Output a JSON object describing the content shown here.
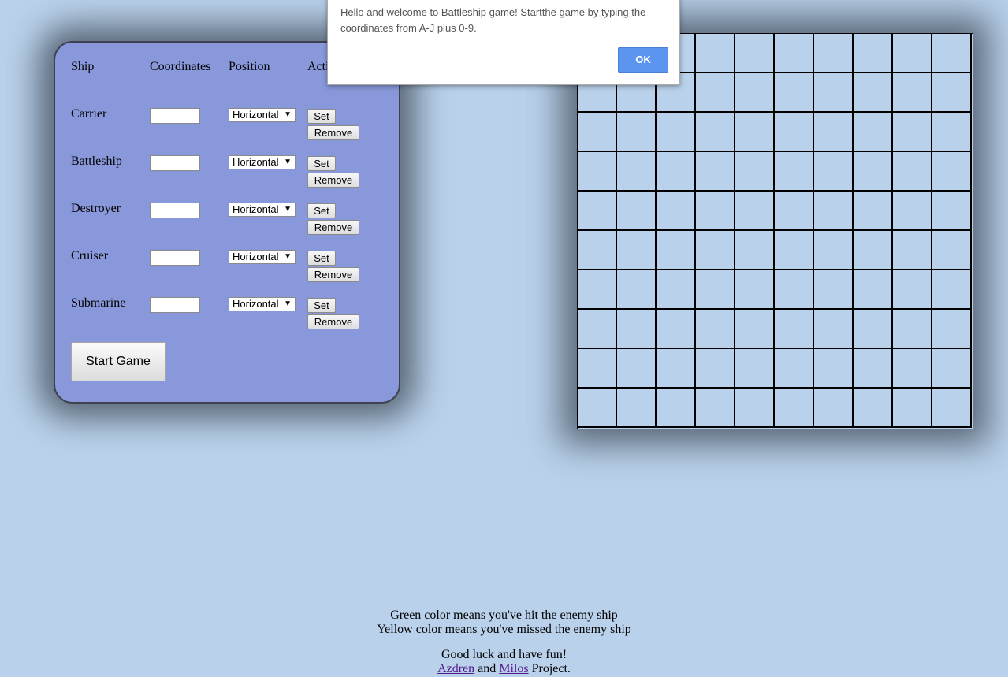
{
  "setup": {
    "headers": {
      "ship": "Ship",
      "coordinates": "Coordinates",
      "position": "Position",
      "actions": "Actions"
    },
    "ships": [
      {
        "name": "Carrier",
        "coordinates": "",
        "position": "Horizontal",
        "set_label": "Set",
        "remove_label": "Remove"
      },
      {
        "name": "Battleship",
        "coordinates": "",
        "position": "Horizontal",
        "set_label": "Set",
        "remove_label": "Remove"
      },
      {
        "name": "Destroyer",
        "coordinates": "",
        "position": "Horizontal",
        "set_label": "Set",
        "remove_label": "Remove"
      },
      {
        "name": "Cruiser",
        "coordinates": "",
        "position": "Horizontal",
        "set_label": "Set",
        "remove_label": "Remove"
      },
      {
        "name": "Submarine",
        "coordinates": "",
        "position": "Horizontal",
        "set_label": "Set",
        "remove_label": "Remove"
      }
    ],
    "start_label": "Start Game"
  },
  "board": {
    "rows": 10,
    "cols": 10,
    "cell_color": "#b9d1ea"
  },
  "alert": {
    "message": "Hello and welcome to Battleship game! Startthe game by typing the coordinates from A-J plus 0-9.",
    "ok_label": "OK"
  },
  "footer": {
    "line1": "Green color means you've hit the enemy ship",
    "line2": "Yellow color means you've missed the enemy ship",
    "line3": "Good luck and have fun!",
    "author1": "Azdren",
    "and_text": "and",
    "author2": "Milos",
    "project_text": "Project."
  },
  "colors": {
    "background": "#b9d1ea",
    "panel": "#8998da",
    "alert_button": "#5b95ef"
  }
}
